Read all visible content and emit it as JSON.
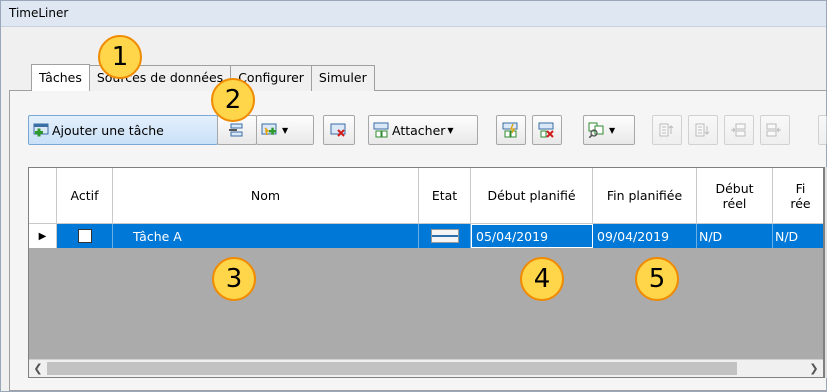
{
  "window": {
    "title": "TimeLiner"
  },
  "tabs": [
    {
      "label": "Tâches",
      "active": true
    },
    {
      "label": "Sources de données",
      "active": false
    },
    {
      "label": "Configurer",
      "active": false
    },
    {
      "label": "Simuler",
      "active": false
    }
  ],
  "toolbar": {
    "add_task_label": "Ajouter une tâche",
    "attach_label": "Attacher"
  },
  "grid": {
    "columns": {
      "active": "Actif",
      "name": "Nom",
      "state": "Etat",
      "planned_start": "Début planifié",
      "planned_end": "Fin planifiée",
      "actual_start_line1": "Début",
      "actual_start_line2": "réel",
      "actual_end_line1": "Fi",
      "actual_end_line2": "rée"
    },
    "rows": [
      {
        "active": true,
        "name": "Tâche A",
        "planned_start": "05/04/2019",
        "planned_end": "09/04/2019",
        "actual_start": "N/D",
        "actual_end": "N/D"
      }
    ]
  },
  "callouts": [
    "1",
    "2",
    "3",
    "4",
    "5"
  ],
  "colors": {
    "selection": "#0078d7",
    "callout_fill": "#ffd54a",
    "callout_border": "#f08a00"
  },
  "icons": [
    "add-task-icon",
    "insert-task-icon",
    "auto-add-icon",
    "delete-task-icon",
    "attach-icon",
    "attach-rules-icon",
    "detach-icon",
    "find-items-icon",
    "move-up-icon",
    "move-down-icon",
    "indent-icon",
    "outdent-icon",
    "row-pointer-icon",
    "scroll-left-icon",
    "scroll-right-icon"
  ]
}
